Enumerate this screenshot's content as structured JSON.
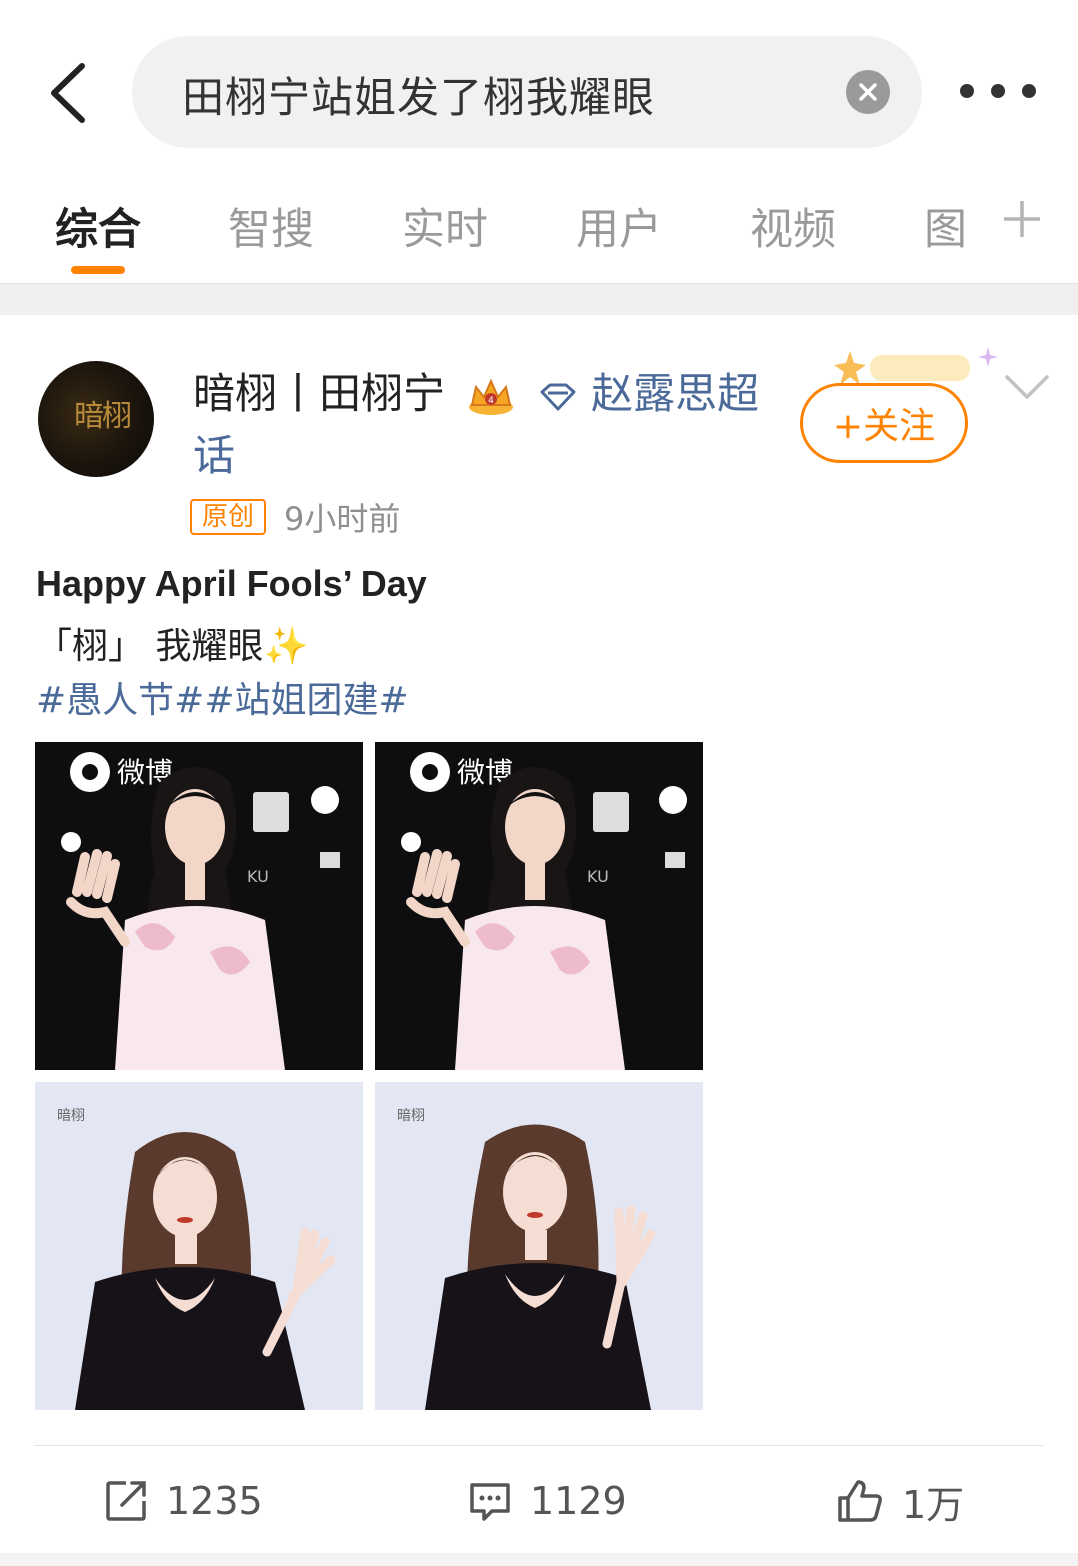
{
  "search": {
    "query": "田栩宁站姐发了栩我耀眼",
    "clear_icon": "clear-icon",
    "back_icon": "back-arrow-icon",
    "more_icon": "more-dots-icon"
  },
  "tabs": [
    {
      "label": "综合",
      "active": true
    },
    {
      "label": "智搜",
      "active": false
    },
    {
      "label": "实时",
      "active": false
    },
    {
      "label": "用户",
      "active": false
    },
    {
      "label": "视频",
      "active": false
    },
    {
      "label": "图",
      "active": false
    }
  ],
  "accent_color": "#ff8200",
  "link_color": "#4b6a99",
  "post": {
    "avatar_text": "暗栩",
    "username": "暗栩丨田栩宁",
    "supertopic": "赵露思超话",
    "follow_label": "+关注",
    "badge": "原创",
    "time": "9小时前",
    "title": "Happy April Fools’ Day",
    "line2": "「栩」 我耀眼",
    "sparkle": "✨",
    "hashtags": "#愚人节##站姐团建#",
    "photos": [
      {
        "scene": "red-carpet-dark-backdrop",
        "watermark": "微博"
      },
      {
        "scene": "red-carpet-dark-backdrop",
        "watermark": "微博"
      },
      {
        "scene": "light-backdrop-black-dress",
        "watermark": "暗栩"
      },
      {
        "scene": "light-backdrop-black-dress",
        "watermark": "暗栩"
      }
    ],
    "actions": {
      "repost": "1235",
      "comment": "1129",
      "like": "1万"
    }
  }
}
